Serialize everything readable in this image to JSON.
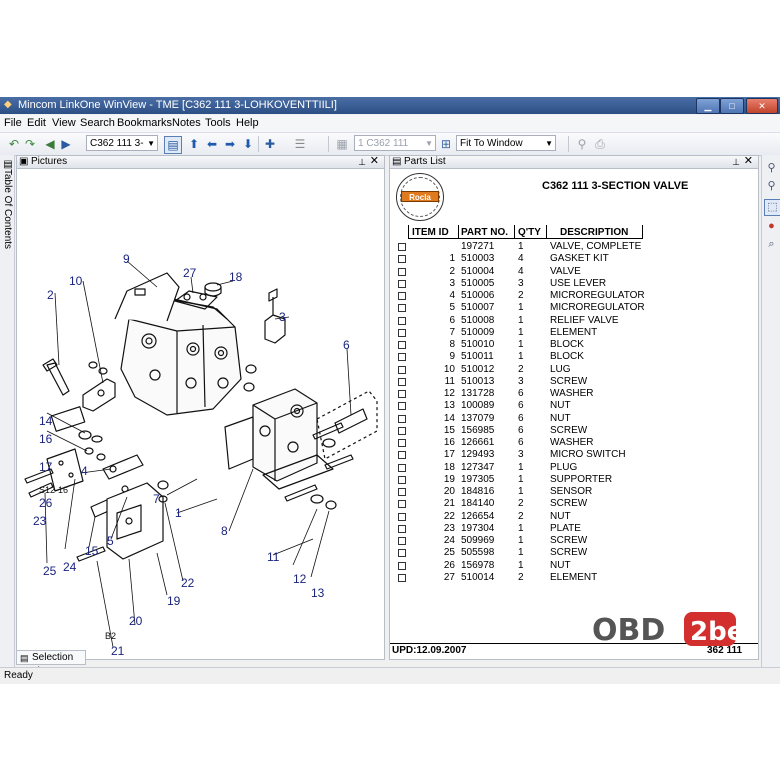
{
  "window": {
    "title": "Mincom LinkOne WinView - TME [C362 111  3-LOHKOVENTTIILI]"
  },
  "menu": [
    "File",
    "Edit",
    "View",
    "Search",
    "Bookmarks",
    "Notes",
    "Tools",
    "Help"
  ],
  "toolbar": {
    "book_combo": "C362 111  3-",
    "page_combo": "1 C362 111",
    "zoom_combo": "Fit To Window"
  },
  "sidebar": {
    "toc_tab": "Table Of Contents"
  },
  "pictures_pane": {
    "title": "Pictures",
    "callouts": [
      "2",
      "10",
      "9",
      "27",
      "18",
      "3",
      "6",
      "14",
      "16",
      "17",
      "S12-16",
      "26",
      "23",
      "4",
      "7",
      "1",
      "8",
      "11",
      "12",
      "13",
      "5",
      "15",
      "24",
      "25",
      "19",
      "22",
      "B2",
      "20",
      "21"
    ]
  },
  "parts_pane": {
    "title": "Parts List",
    "logo_text": "Rocla",
    "heading": "C362  111   3-SECTION VALVE",
    "columns": [
      "ITEM ID",
      "PART NO.",
      "Q'TY",
      "DESCRIPTION"
    ],
    "rows": [
      {
        "item": "",
        "part": "197271",
        "qty": "1",
        "desc": "VALVE, COMPLETE"
      },
      {
        "item": "1",
        "part": "510003",
        "qty": "4",
        "desc": "GASKET KIT"
      },
      {
        "item": "2",
        "part": "510004",
        "qty": "4",
        "desc": "VALVE"
      },
      {
        "item": "3",
        "part": "510005",
        "qty": "3",
        "desc": "USE LEVER"
      },
      {
        "item": "4",
        "part": "510006",
        "qty": "2",
        "desc": "MICROREGULATOR"
      },
      {
        "item": "5",
        "part": "510007",
        "qty": "1",
        "desc": "MICROREGULATOR"
      },
      {
        "item": "6",
        "part": "510008",
        "qty": "1",
        "desc": "RELIEF VALVE"
      },
      {
        "item": "7",
        "part": "510009",
        "qty": "1",
        "desc": "ELEMENT"
      },
      {
        "item": "8",
        "part": "510010",
        "qty": "1",
        "desc": "BLOCK"
      },
      {
        "item": "9",
        "part": "510011",
        "qty": "1",
        "desc": "BLOCK"
      },
      {
        "item": "10",
        "part": "510012",
        "qty": "2",
        "desc": "LUG"
      },
      {
        "item": "11",
        "part": "510013",
        "qty": "3",
        "desc": "SCREW"
      },
      {
        "item": "12",
        "part": "131728",
        "qty": "6",
        "desc": "WASHER"
      },
      {
        "item": "13",
        "part": "100089",
        "qty": "6",
        "desc": "NUT"
      },
      {
        "item": "14",
        "part": "137079",
        "qty": "6",
        "desc": "NUT"
      },
      {
        "item": "15",
        "part": "156985",
        "qty": "6",
        "desc": "SCREW"
      },
      {
        "item": "16",
        "part": "126661",
        "qty": "6",
        "desc": "WASHER"
      },
      {
        "item": "17",
        "part": "129493",
        "qty": "3",
        "desc": "MICRO SWITCH"
      },
      {
        "item": "18",
        "part": "127347",
        "qty": "1",
        "desc": "PLUG"
      },
      {
        "item": "19",
        "part": "197305",
        "qty": "1",
        "desc": "SUPPORTER"
      },
      {
        "item": "20",
        "part": "184816",
        "qty": "1",
        "desc": "SENSOR"
      },
      {
        "item": "21",
        "part": "184140",
        "qty": "2",
        "desc": "SCREW"
      },
      {
        "item": "22",
        "part": "126654",
        "qty": "2",
        "desc": "NUT"
      },
      {
        "item": "23",
        "part": "197304",
        "qty": "1",
        "desc": "PLATE"
      },
      {
        "item": "24",
        "part": "509969",
        "qty": "1",
        "desc": "SCREW"
      },
      {
        "item": "25",
        "part": "505598",
        "qty": "1",
        "desc": "SCREW"
      },
      {
        "item": "26",
        "part": "156978",
        "qty": "1",
        "desc": "NUT"
      },
      {
        "item": "27",
        "part": "510014",
        "qty": "2",
        "desc": "ELEMENT"
      }
    ],
    "footer_left": "UPD:12.09.2007",
    "footer_right": "362 111"
  },
  "bottom_tab": "Selection List",
  "status": "Ready",
  "watermark": {
    "left": "OBD",
    "right": "2be"
  },
  "colors": {
    "titlebar": "#2c4f86",
    "callout": "#1a237e",
    "logo_badge": "#e07a1f",
    "watermark_red": "#d32f2f"
  }
}
